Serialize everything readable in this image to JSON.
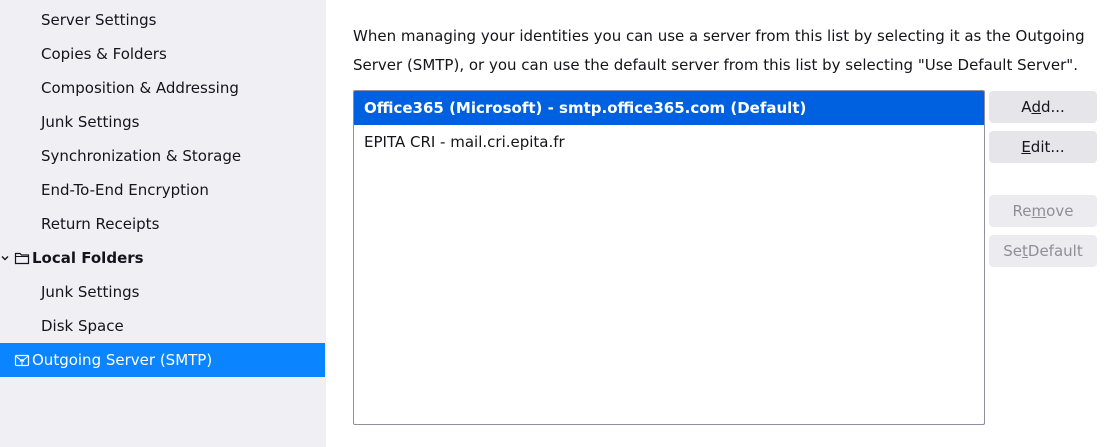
{
  "sidebar": {
    "server_items": [
      "Server Settings",
      "Copies & Folders",
      "Composition & Addressing",
      "Junk Settings",
      "Synchronization & Storage",
      "End-To-End Encryption",
      "Return Receipts"
    ],
    "local_folders": {
      "label": "Local Folders",
      "items": [
        "Junk Settings",
        "Disk Space"
      ]
    },
    "outgoing_server": {
      "label": "Outgoing Server (SMTP)"
    },
    "selection_color": "#0a84ff"
  },
  "main": {
    "description": "When managing your identities you can use a server from this list by selecting it as the Outgoing Server (SMTP), or you can use the default server from this list by selecting \"Use Default Server\".",
    "servers": [
      {
        "label": "Office365 (Microsoft) - smtp.office365.com (Default)",
        "selected": true
      },
      {
        "label": "EPITA CRI - mail.cri.epita.fr",
        "selected": false
      }
    ],
    "buttons": {
      "add": {
        "label": "Add...",
        "pre": "A",
        "key": "d",
        "post": "d..."
      },
      "edit": {
        "label": "Edit...",
        "pre": "",
        "key": "E",
        "post": "dit..."
      },
      "remove": {
        "label": "Remove",
        "pre": "Re",
        "key": "m",
        "post": "ove"
      },
      "set_default": {
        "label": "Set Default",
        "pre": "Se",
        "key": "t",
        "post": " Default"
      }
    }
  }
}
